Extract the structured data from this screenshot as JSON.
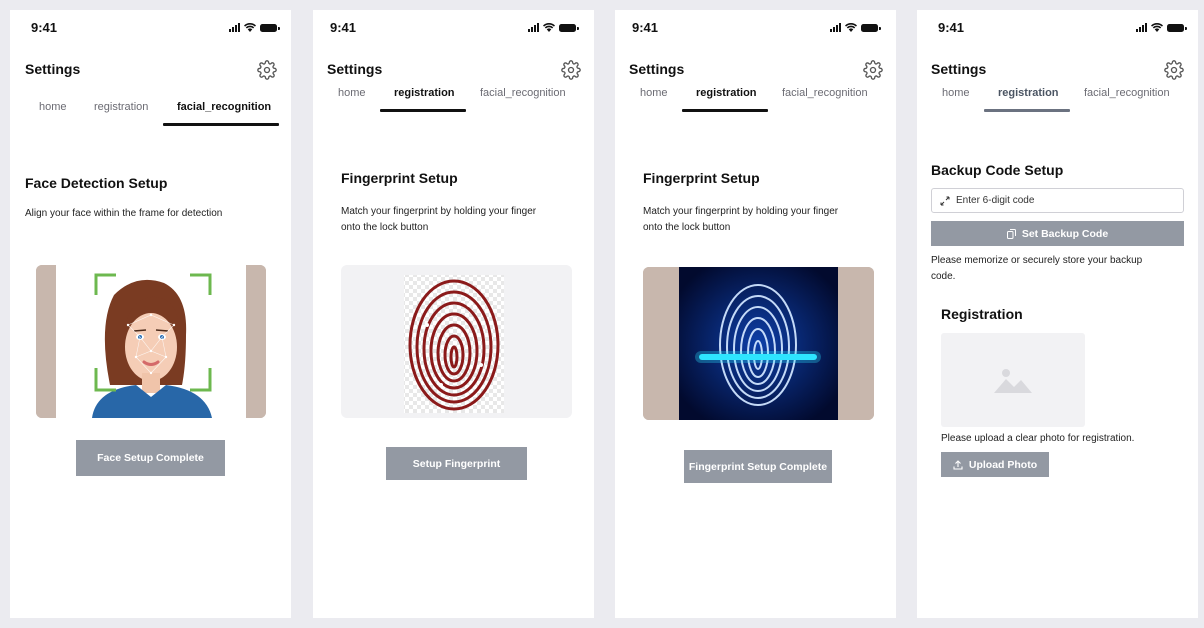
{
  "status": {
    "time": "9:41"
  },
  "header": {
    "title": "Settings"
  },
  "tabs": {
    "home": "home",
    "registration": "registration",
    "facial": "facial_recognition"
  },
  "screen1": {
    "heading": "Face Detection Setup",
    "description": "Align your face within the frame for detection",
    "button": "Face Setup Complete"
  },
  "screen2": {
    "heading": "Fingerprint Setup",
    "description_line1": "Match your fingerprint by holding your finger",
    "description_line2": "onto the lock button",
    "button": "Setup Fingerprint"
  },
  "screen3": {
    "heading": "Fingerprint Setup",
    "description_line1": "Match your fingerprint by holding your finger",
    "description_line2": "onto the lock button",
    "button": "Fingerprint Setup Complete"
  },
  "screen4": {
    "heading": "Backup Code Setup",
    "input_placeholder": "Enter 6-digit code",
    "set_button": "Set Backup Code",
    "backup_note_line1": "Please memorize or securely store your backup",
    "backup_note_line2": "code.",
    "registration_heading": "Registration",
    "upload_note": "Please upload a clear photo for registration.",
    "upload_button": "Upload Photo"
  },
  "colors": {
    "button": "#9399a3",
    "fingerprint_red": "#8b1a1a",
    "scan_glow": "#2ee6ff",
    "frame_green": "#6db84f"
  }
}
